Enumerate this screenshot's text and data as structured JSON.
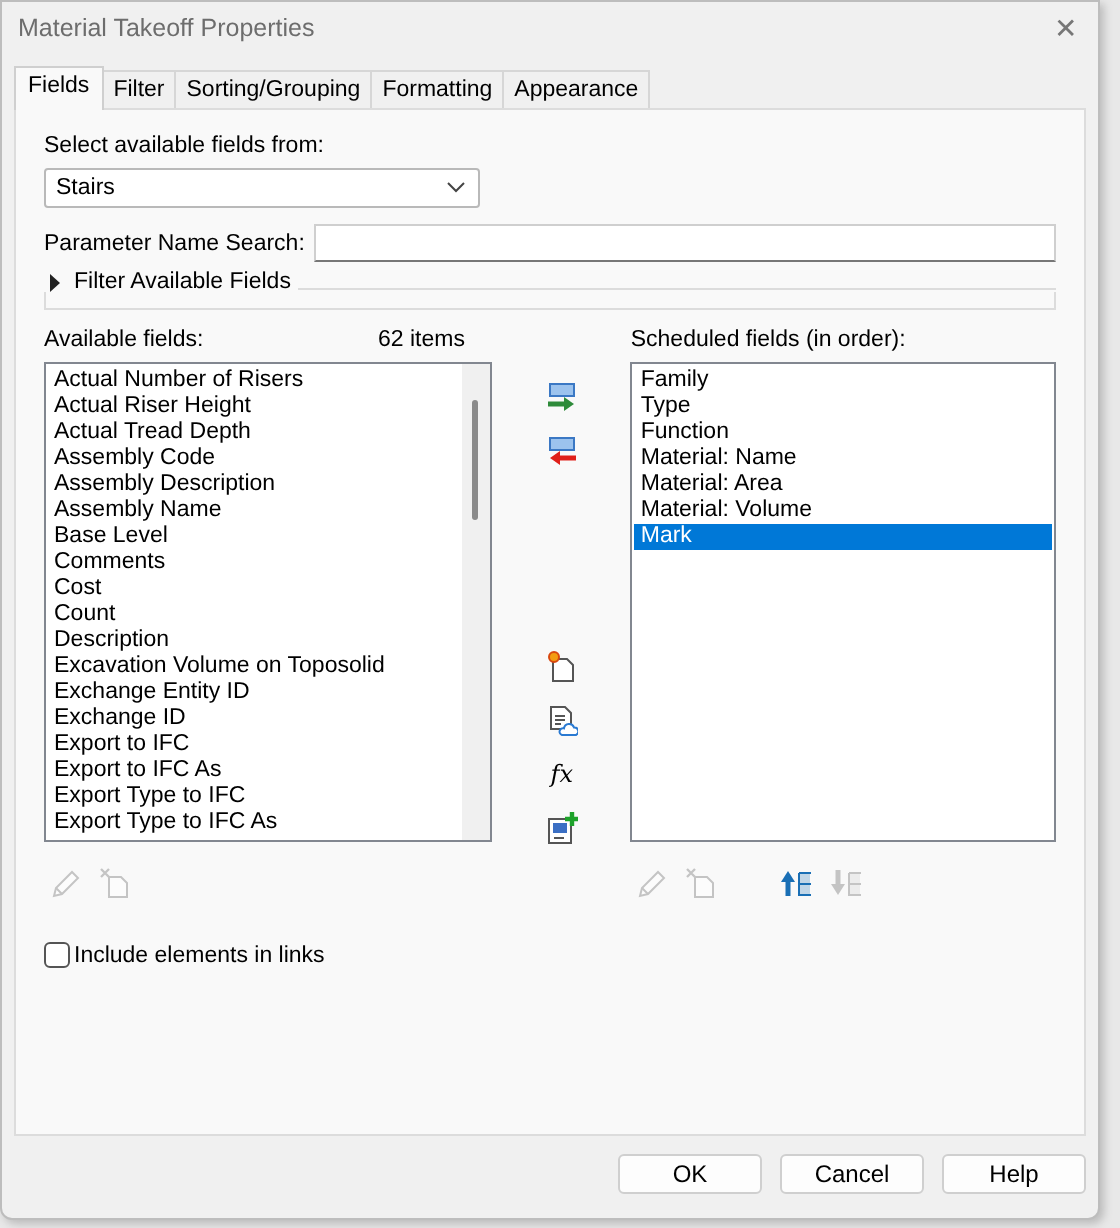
{
  "window": {
    "title": "Material Takeoff Properties",
    "close_glyph": "✕"
  },
  "tabs": [
    {
      "label": "Fields",
      "selected": true
    },
    {
      "label": "Filter",
      "selected": false
    },
    {
      "label": "Sorting/Grouping",
      "selected": false
    },
    {
      "label": "Formatting",
      "selected": false
    },
    {
      "label": "Appearance",
      "selected": false
    }
  ],
  "source": {
    "label": "Select available fields from:",
    "value": "Stairs"
  },
  "search": {
    "label": "Parameter Name Search:"
  },
  "filter_group": {
    "label": "Filter Available Fields",
    "expanded": false
  },
  "available": {
    "label": "Available fields:",
    "count": "62 items",
    "items": [
      "Actual Number of Risers",
      "Actual Riser Height",
      "Actual Tread Depth",
      "Assembly Code",
      "Assembly Description",
      "Assembly Name",
      "Base Level",
      "Comments",
      "Cost",
      "Count",
      "Description",
      "Excavation Volume on Toposolid",
      "Exchange Entity ID",
      "Exchange ID",
      "Export to IFC",
      "Export to IFC As",
      "Export Type to IFC",
      "Export Type to IFC As"
    ]
  },
  "available_tools": [
    {
      "kind": "edit",
      "disabled": true
    },
    {
      "kind": "delete",
      "disabled": true
    }
  ],
  "transfer_tools": [
    {
      "kind": "add",
      "disabled": false
    },
    {
      "kind": "remove",
      "disabled": false
    },
    {
      "kind": "gap"
    },
    {
      "kind": "new-parameter",
      "disabled": false
    },
    {
      "kind": "shared-parameter",
      "disabled": false
    },
    {
      "kind": "formula",
      "glyph": "fx",
      "disabled": false
    },
    {
      "kind": "combine",
      "disabled": false
    }
  ],
  "scheduled": {
    "label": "Scheduled fields (in order):",
    "items": [
      {
        "text": "Family",
        "selected": false
      },
      {
        "text": "Type",
        "selected": false
      },
      {
        "text": "Function",
        "selected": false
      },
      {
        "text": "Material: Name",
        "selected": false
      },
      {
        "text": "Material: Area",
        "selected": false
      },
      {
        "text": "Material: Volume",
        "selected": false
      },
      {
        "text": "Mark",
        "selected": true
      }
    ]
  },
  "scheduled_tools": [
    {
      "kind": "edit",
      "disabled": true
    },
    {
      "kind": "delete",
      "disabled": true
    },
    {
      "kind": "gap"
    },
    {
      "kind": "move-up",
      "disabled": false
    },
    {
      "kind": "move-down",
      "disabled": true
    }
  ],
  "include_links": {
    "label": "Include elements in links",
    "checked": false
  },
  "buttons": [
    "OK",
    "Cancel",
    "Help"
  ]
}
